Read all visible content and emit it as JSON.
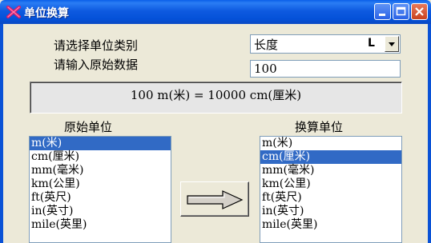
{
  "window": {
    "title": "单位换算"
  },
  "form": {
    "category_label": "请选择单位类别",
    "input_label": "请输入原始数据",
    "category_value": "长度",
    "category_code": "L",
    "input_value": "100"
  },
  "result": {
    "text": "100 m(米) = 10000 cm(厘米)"
  },
  "source": {
    "label": "原始单位",
    "items": [
      "m(米)",
      "cm(厘米)",
      "mm(毫米)",
      "km(公里)",
      "ft(英尺)",
      "in(英寸)",
      "mile(英里)"
    ],
    "selected_index": 0
  },
  "target": {
    "label": "换算单位",
    "items": [
      "m(米)",
      "cm(厘米)",
      "mm(毫米)",
      "km(公里)",
      "ft(英尺)",
      "in(英寸)",
      "mile(英里)"
    ],
    "selected_index": 1
  },
  "icons": {
    "app": "app-x-icon",
    "minimize": "minimize-icon",
    "maximize": "maximize-icon",
    "close": "close-icon",
    "dropdown": "chevron-down-icon",
    "convert": "arrow-right-icon"
  }
}
